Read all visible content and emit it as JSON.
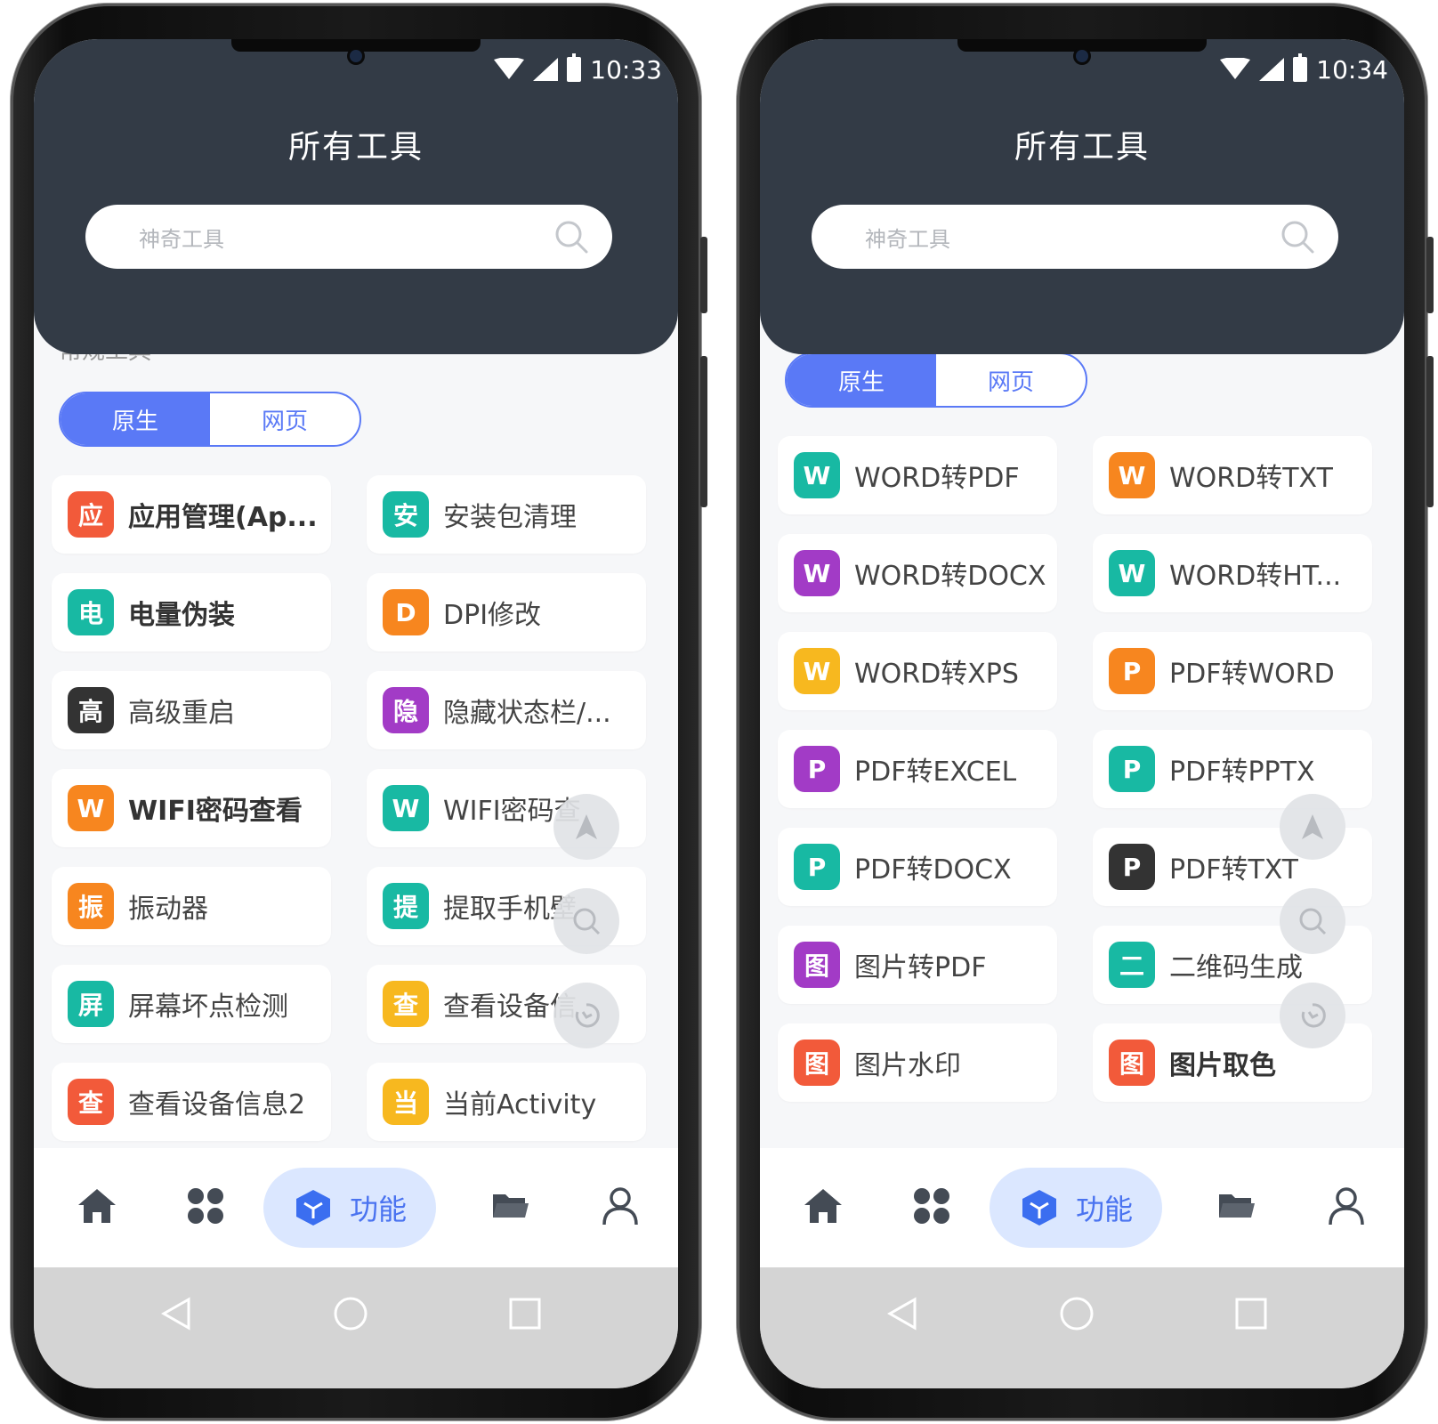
{
  "left": {
    "status_time": "10:33",
    "title": "所有工具",
    "search_placeholder": "神奇工具",
    "hidden_label": "常规工具",
    "seg": [
      "原生",
      "网页"
    ],
    "tools": [
      {
        "badge": "应",
        "label": "应用管理(Ap...",
        "color": "#f25a3a",
        "bold": true
      },
      {
        "badge": "安",
        "label": "安装包清理",
        "color": "#18b9a3",
        "bold": false
      },
      {
        "badge": "电",
        "label": "电量伪装",
        "color": "#18b9a3",
        "bold": true
      },
      {
        "badge": "D",
        "label": "DPI修改",
        "color": "#f7861f",
        "bold": false
      },
      {
        "badge": "高",
        "label": "高级重启",
        "color": "#333333",
        "bold": false
      },
      {
        "badge": "隐",
        "label": "隐藏状态栏/...",
        "color": "#a23bc6",
        "bold": false
      },
      {
        "badge": "W",
        "label": "WIFI密码查看",
        "color": "#f7861f",
        "bold": true
      },
      {
        "badge": "W",
        "label": "WIFI密码查",
        "color": "#18b9a3",
        "bold": false
      },
      {
        "badge": "振",
        "label": "振动器",
        "color": "#f7861f",
        "bold": false
      },
      {
        "badge": "提",
        "label": "提取手机壁",
        "color": "#18b9a3",
        "bold": false
      },
      {
        "badge": "屏",
        "label": "屏幕坏点检测",
        "color": "#18b9a3",
        "bold": false
      },
      {
        "badge": "查",
        "label": "查看设备信",
        "color": "#f7b81f",
        "bold": false
      },
      {
        "badge": "查",
        "label": "查看设备信息2",
        "color": "#f25a3a",
        "bold": false
      },
      {
        "badge": "当",
        "label": "当前Activity",
        "color": "#f7b81f",
        "bold": false
      }
    ],
    "tab_active_label": "功能"
  },
  "right": {
    "status_time": "10:34",
    "title": "所有工具",
    "search_placeholder": "神奇工具",
    "seg": [
      "原生",
      "网页"
    ],
    "tools": [
      {
        "badge": "W",
        "label": "WORD转PDF",
        "color": "#18b9a3",
        "bold": false
      },
      {
        "badge": "W",
        "label": "WORD转TXT",
        "color": "#f7861f",
        "bold": false
      },
      {
        "badge": "W",
        "label": "WORD转DOCX",
        "color": "#a23bc6",
        "bold": false
      },
      {
        "badge": "W",
        "label": "WORD转HT...",
        "color": "#18b9a3",
        "bold": false
      },
      {
        "badge": "W",
        "label": "WORD转XPS",
        "color": "#f7b81f",
        "bold": false
      },
      {
        "badge": "P",
        "label": "PDF转WORD",
        "color": "#f7861f",
        "bold": false
      },
      {
        "badge": "P",
        "label": "PDF转EXCEL",
        "color": "#a23bc6",
        "bold": false
      },
      {
        "badge": "P",
        "label": "PDF转PPTX",
        "color": "#18b9a3",
        "bold": false
      },
      {
        "badge": "P",
        "label": "PDF转DOCX",
        "color": "#18b9a3",
        "bold": false
      },
      {
        "badge": "P",
        "label": "PDF转TXT",
        "color": "#333333",
        "bold": false
      },
      {
        "badge": "图",
        "label": "图片转PDF",
        "color": "#a23bc6",
        "bold": false
      },
      {
        "badge": "二",
        "label": "二维码生成",
        "color": "#18b9a3",
        "bold": false
      },
      {
        "badge": "图",
        "label": "图片水印",
        "color": "#f25a3a",
        "bold": false
      },
      {
        "badge": "图",
        "label": "图片取色",
        "color": "#f25a3a",
        "bold": true
      }
    ],
    "tab_active_label": "功能"
  },
  "icons": [
    "home-icon",
    "apps-grid-icon",
    "cube-icon",
    "folder-icon",
    "user-icon",
    "back-icon",
    "home-circle-icon",
    "recents-icon",
    "search-icon",
    "arrow-up-icon",
    "history-icon"
  ],
  "colors": {
    "header": "#333b46",
    "accent": "#5a79f6",
    "tab_pill": "#dbe7ff"
  }
}
